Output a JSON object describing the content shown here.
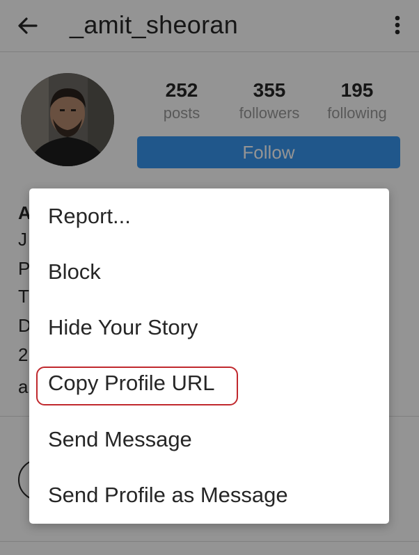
{
  "header": {
    "username": "_amit_sheoran",
    "back_icon": "arrow-left-icon",
    "more_icon": "more-vertical-icon"
  },
  "profile": {
    "stats": [
      {
        "value": "252",
        "label": "posts"
      },
      {
        "value": "355",
        "label": "followers"
      },
      {
        "value": "195",
        "label": "following"
      }
    ],
    "follow_label": "Follow",
    "bio_peek": [
      "A",
      "J",
      "P",
      "T",
      "D",
      "2",
      "a"
    ]
  },
  "menu": {
    "items": [
      {
        "label": "Report..."
      },
      {
        "label": "Block"
      },
      {
        "label": "Hide Your Story"
      },
      {
        "label": "Copy Profile URL"
      },
      {
        "label": "Send Message"
      },
      {
        "label": "Send Profile as Message"
      }
    ],
    "highlighted_item": "Copy Profile URL",
    "highlight_color": "#c0282d"
  },
  "colors": {
    "follow_button": "#3897f0",
    "overlay": "rgba(0,0,0,0.42)"
  }
}
